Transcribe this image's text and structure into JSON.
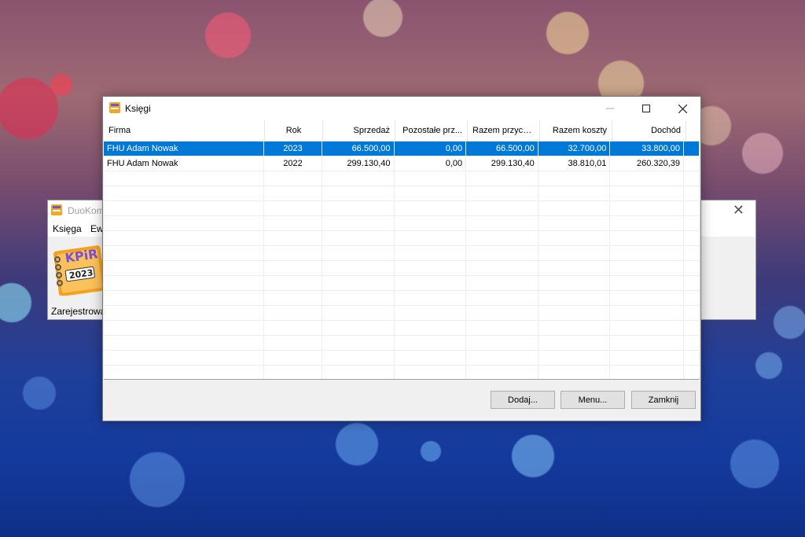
{
  "background_window": {
    "title": "DuoKom",
    "menu": [
      "Księga",
      "Ew"
    ],
    "logo_text": "KPiR",
    "logo_year": "2023",
    "status": "Zarejestrowa"
  },
  "dialog": {
    "title": "Księgi",
    "columns": [
      "Firma",
      "Rok",
      "Sprzedaż",
      "Pozostałe prz...",
      "Razem przych...",
      "Razem koszty",
      "Dochód"
    ],
    "rows": [
      [
        "FHU Adam Nowak",
        "2023",
        "66.500,00",
        "0,00",
        "66.500,00",
        "32.700,00",
        "33.800,00"
      ],
      [
        "FHU Adam Nowak",
        "2022",
        "299.130,40",
        "0,00",
        "299.130,40",
        "38.810,01",
        "260.320,39"
      ]
    ],
    "selected_row": 0,
    "empty_rows": 14,
    "buttons": {
      "add": "Dodaj...",
      "menu": "Menu...",
      "close": "Zamknij"
    }
  },
  "colors": {
    "selection": "#0078d7",
    "window_bg": "#f0f0f0",
    "button_bg": "#e1e1e1"
  }
}
